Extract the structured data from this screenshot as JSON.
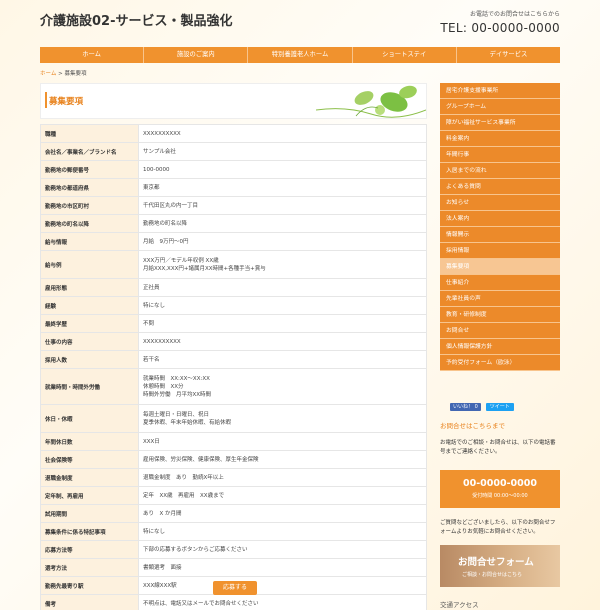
{
  "header": {
    "site_title": "介護施設02-サービス・製品強化",
    "tel_note": "お電話でのお問合せはこちらから",
    "tel": "TEL: 00-0000-0000"
  },
  "nav": [
    "ホーム",
    "施設のご案内",
    "特別養護老人ホーム",
    "ショートステイ",
    "デイサービス"
  ],
  "breadcrumb": {
    "home": "ホーム",
    "separator": " > ",
    "current": "募集要項"
  },
  "main": {
    "title": "募集要項"
  },
  "table": [
    {
      "label": "職種",
      "value": "XXXXXXXXXX"
    },
    {
      "label": "会社名／事業名／ブランド名",
      "value": "サンプル会社"
    },
    {
      "label": "勤務地の郵便番号",
      "value": "100-0000"
    },
    {
      "label": "勤務地の都道府県",
      "value": "東京都"
    },
    {
      "label": "勤務地の市区町村",
      "value": "千代田区丸の内一丁目"
    },
    {
      "label": "勤務地の町名以降",
      "value": "勤務地の町名以降"
    },
    {
      "label": "給与情報",
      "value": "月給　9万円〜0円"
    },
    {
      "label": "給与例",
      "value": "XXX万円／モデル年収例 XX歳\n月給XXX,XXX円+諸属月XX時間+各種手当+賞与"
    },
    {
      "label": "雇用形態",
      "value": "正社員"
    },
    {
      "label": "経験",
      "value": "特になし"
    },
    {
      "label": "最終学歴",
      "value": "不問"
    },
    {
      "label": "仕事の内容",
      "value": "XXXXXXXXXX"
    },
    {
      "label": "採用人数",
      "value": "若干名"
    },
    {
      "label": "就業時間・時間外労働",
      "value": "就業時間　XX:XX〜XX:XX\n休憩時間　XX分\n時間外労働　月平均XX時間"
    },
    {
      "label": "休日・休暇",
      "value": "毎週土曜日・日曜日、祝日\n夏季休暇、年末年始休暇、有給休暇"
    },
    {
      "label": "年間休日数",
      "value": "XXX日"
    },
    {
      "label": "社会保険等",
      "value": "雇用保険、労災保険、健康保険、厚生年金保険"
    },
    {
      "label": "退職金制度",
      "value": "退職金制度　あり　勤続X年以上"
    },
    {
      "label": "定年制、再雇用",
      "value": "定年　XX歳　再雇用　XX歳まで"
    },
    {
      "label": "試用期間",
      "value": "あり　X か月間"
    },
    {
      "label": "募集条件に係る特記事項",
      "value": "特になし"
    },
    {
      "label": "応募方法等",
      "value": "下部の応募するボタンからご応募ください"
    },
    {
      "label": "選考方法",
      "value": "書類選考　面接"
    },
    {
      "label": "勤務先最寄り駅",
      "value": "XXX線XXX駅"
    },
    {
      "label": "備考",
      "value": "不明点は、電話又はメールでお問合せください"
    }
  ],
  "apply_label": "応募する",
  "sidebar": [
    "居宅介護支援事業所",
    "グループホーム",
    "障がい福祉サービス事業所",
    "料金案内",
    "年間行事",
    "入居までの流れ",
    "よくある質問",
    "お知らせ",
    "法人案内",
    "情報開示",
    "採用情報",
    "募集要項",
    "仕事紹介",
    "先輩社員の声",
    "教育・研修制度",
    "お問合せ",
    "個人情報保護方針",
    "予約受付フォーム（欧泳）"
  ],
  "sidebar_active_index": 11,
  "share": {
    "like": "いいね！ 0",
    "tweet": "ツイート"
  },
  "contact": {
    "heading": "お問合せはこちらまで",
    "text1": "お電話でのご相談・お問合せは、以下の電話番号までご連絡ください。",
    "tel": "00-0000-0000",
    "hours": "受付時間 00:00〜00:00",
    "text2": "ご質問などございましたら、以下のお問合せフォームよりお気軽にお問合せください。",
    "form_title": "お問合せフォーム",
    "form_sub": "ご相談・お問合せはこちら"
  },
  "access_heading": "交通アクセス",
  "colors": {
    "accent": "#f0922e",
    "accent_light": "#fdf1de",
    "sidebar_active": "#f7c693"
  }
}
